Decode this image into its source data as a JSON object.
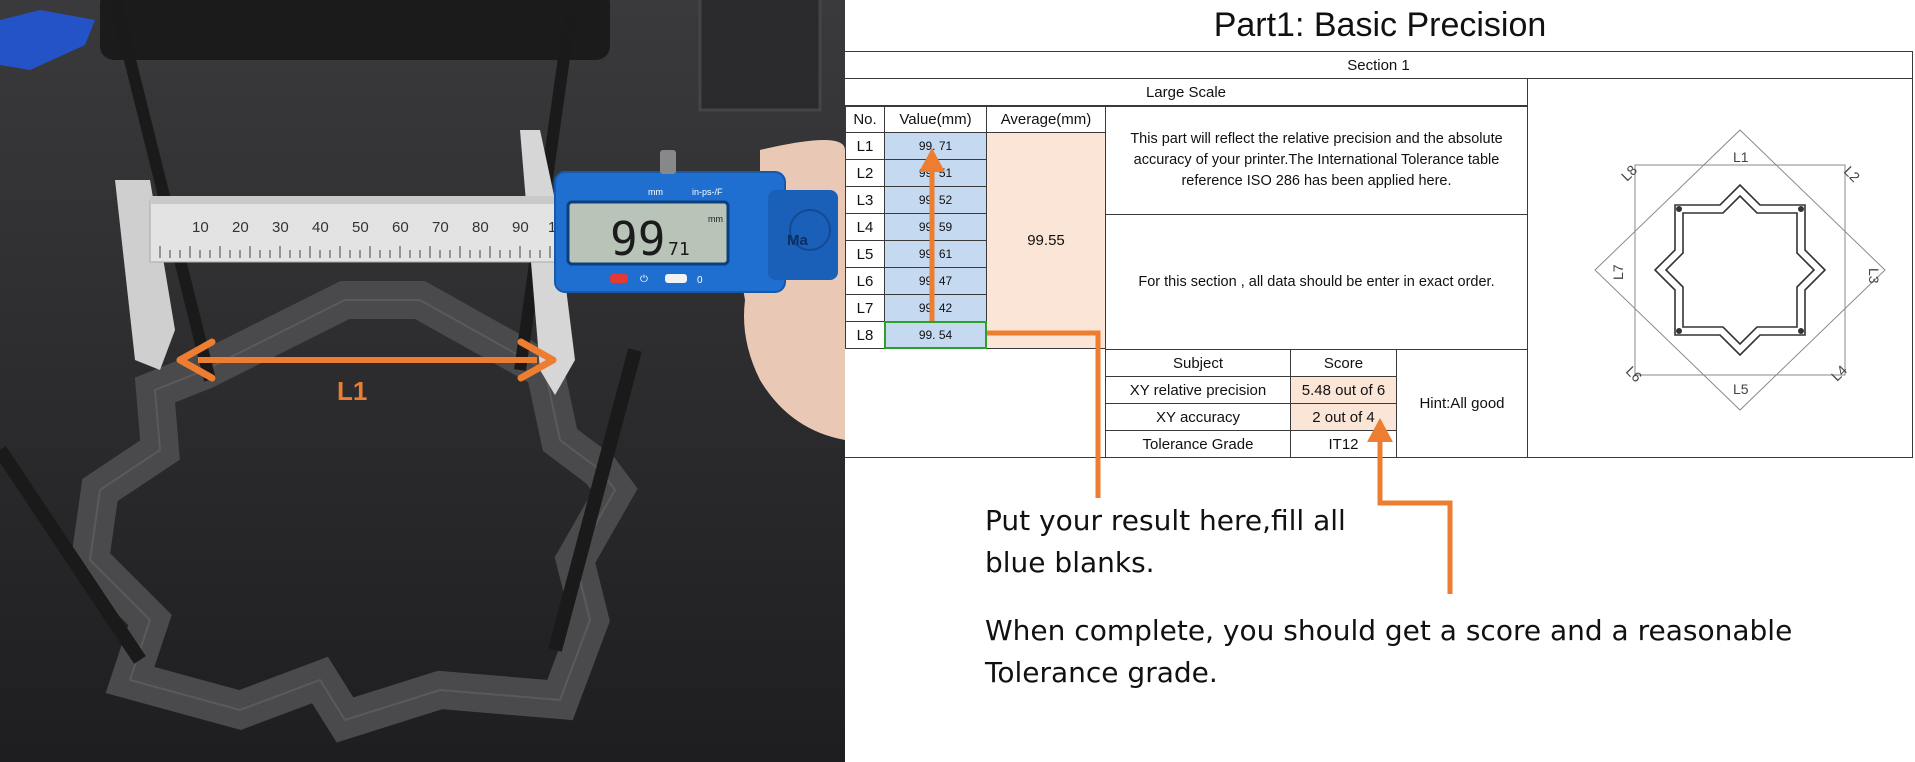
{
  "photo": {
    "measurement_label": "L1",
    "caliper_reading": "99.71",
    "caliper_reading_int": "99",
    "caliper_reading_dec": "71",
    "caliper_units": "mm",
    "caliper_mode": "in-ps-/F",
    "caliper_zero": "0",
    "caliper_brand_partial": "Ma",
    "ruler_ticks": [
      "10",
      "20",
      "30",
      "40",
      "50",
      "60",
      "70",
      "80",
      "90",
      "10"
    ],
    "icons": [
      "caliper-photo",
      "double-arrow-icon"
    ]
  },
  "sheet": {
    "title": "Part1: Basic Precision",
    "section": "Section 1",
    "scale": "Large Scale",
    "headers": {
      "no": "No.",
      "value": "Value(mm)",
      "average": "Average(mm)"
    },
    "rows": [
      {
        "no": "L1",
        "value": "99. 71"
      },
      {
        "no": "L2",
        "value": "99. 51"
      },
      {
        "no": "L3",
        "value": "99. 52"
      },
      {
        "no": "L4",
        "value": "99. 59"
      },
      {
        "no": "L5",
        "value": "99. 61"
      },
      {
        "no": "L6",
        "value": "99. 47"
      },
      {
        "no": "L7",
        "value": "99. 42"
      },
      {
        "no": "L8",
        "value": "99. 54"
      }
    ],
    "average": "99.55",
    "description": "This part will reflect the relative precision and the absolute accuracy of your printer.The International Tolerance table reference ISO 286 has been applied here.",
    "instruction": "For this section , all data should be enter in exact order.",
    "score_headers": {
      "subject": "Subject",
      "score": "Score"
    },
    "scores": [
      {
        "subject": "XY relative precision",
        "score": "5.48 out of 6"
      },
      {
        "subject": "XY accuracy",
        "score": "2 out of 4"
      },
      {
        "subject": "Tolerance Grade",
        "score": "IT12"
      }
    ],
    "hint": "Hint:All good",
    "diagram_labels": [
      "L1",
      "L2",
      "L3",
      "L4",
      "L5",
      "L6",
      "L7",
      "L8"
    ]
  },
  "notes": {
    "line1": "Put your result here,fill all",
    "line2": "blue blanks.",
    "line3": "When complete, you should get a score and a reasonable",
    "line4": "Tolerance grade."
  },
  "colors": {
    "accent_orange": "#ed7d31",
    "blue_cell": "#c5d9f1",
    "peach_cell": "#fbe5d6",
    "selection": "#2ca02c"
  }
}
